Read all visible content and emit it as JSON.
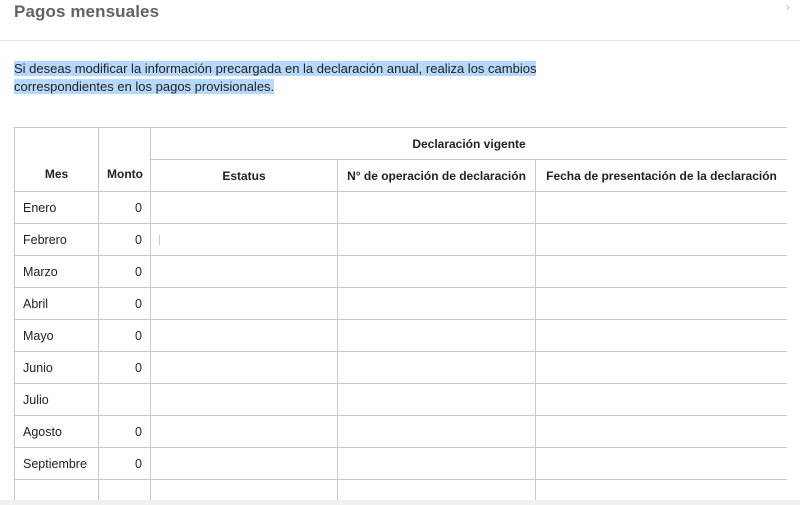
{
  "dialog": {
    "title": "Pagos mensuales",
    "close_symbol": "›"
  },
  "notice": {
    "line1": "Si deseas modificar la información precargada en la declaración anual, realiza los cambios",
    "line2": "correspondientes en los pagos provisionales."
  },
  "table": {
    "group_header": "Declaración vigente",
    "headers": {
      "mes": "Mes",
      "monto": "Monto",
      "estatus": "Estatus",
      "operacion": "N° de operación de declaración",
      "fecha": "Fecha de presentación de la declaración"
    },
    "rows": [
      {
        "mes": "Enero",
        "monto": "0",
        "estatus": "",
        "operacion": "",
        "fecha": ""
      },
      {
        "mes": "Febrero",
        "monto": "0",
        "estatus": "",
        "operacion": "",
        "fecha": ""
      },
      {
        "mes": "Marzo",
        "monto": "0",
        "estatus": "",
        "operacion": "",
        "fecha": ""
      },
      {
        "mes": "Abril",
        "monto": "0",
        "estatus": "",
        "operacion": "",
        "fecha": ""
      },
      {
        "mes": "Mayo",
        "monto": "0",
        "estatus": "",
        "operacion": "",
        "fecha": ""
      },
      {
        "mes": "Junio",
        "monto": "0",
        "estatus": "",
        "operacion": "",
        "fecha": ""
      },
      {
        "mes": "Julio",
        "monto": "",
        "estatus": "",
        "operacion": "",
        "fecha": ""
      },
      {
        "mes": "Agosto",
        "monto": "0",
        "estatus": "",
        "operacion": "",
        "fecha": ""
      },
      {
        "mes": "Septiembre",
        "monto": "0",
        "estatus": "",
        "operacion": "",
        "fecha": ""
      },
      {
        "mes": "",
        "monto": "",
        "estatus": "",
        "operacion": "",
        "fecha": ""
      }
    ]
  },
  "colors": {
    "title": "#5f6368",
    "highlight": "#b6d8fb",
    "border": "#c9c9c9"
  }
}
